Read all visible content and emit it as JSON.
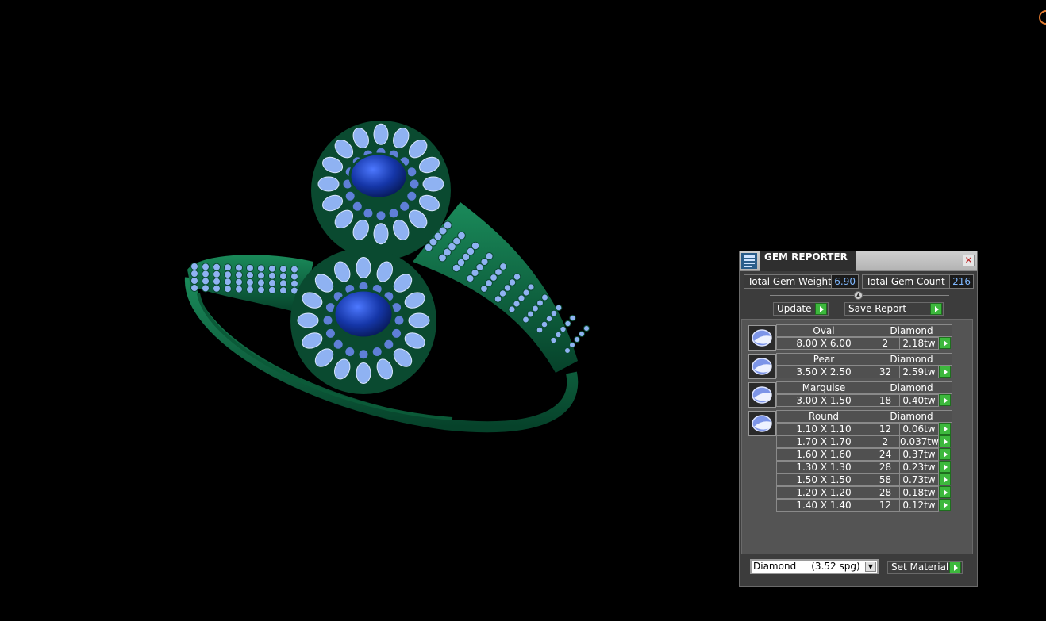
{
  "panel": {
    "title": "GEM REPORTER",
    "close_glyph": "✕",
    "total_weight_label": "Total Gem Weight",
    "total_weight_value": "6.90",
    "total_count_label": "Total Gem Count",
    "total_count_value": "216",
    "update_label": "Update",
    "save_report_label": "Save Report",
    "material_value": "Diamond     (3.52 spg)",
    "set_material_label": "Set Material"
  },
  "gem_groups": [
    {
      "shape": "Oval",
      "material": "Diamond",
      "rows": [
        {
          "size": "8.00 X 6.00",
          "count": "2",
          "weight": "2.18tw"
        }
      ]
    },
    {
      "shape": "Pear",
      "material": "Diamond",
      "rows": [
        {
          "size": "3.50 X 2.50",
          "count": "32",
          "weight": "2.59tw"
        }
      ]
    },
    {
      "shape": "Marquise",
      "material": "Diamond",
      "rows": [
        {
          "size": "3.00 X 1.50",
          "count": "18",
          "weight": "0.40tw"
        }
      ]
    },
    {
      "shape": "Round",
      "material": "Diamond",
      "rows": [
        {
          "size": "1.10 X 1.10",
          "count": "12",
          "weight": "0.06tw"
        },
        {
          "size": "1.70 X 1.70",
          "count": "2",
          "weight": "0.037tw"
        },
        {
          "size": "1.60 X 1.60",
          "count": "24",
          "weight": "0.37tw"
        },
        {
          "size": "1.30 X 1.30",
          "count": "28",
          "weight": "0.23tw"
        },
        {
          "size": "1.50 X 1.50",
          "count": "58",
          "weight": "0.73tw"
        },
        {
          "size": "1.20 X 1.20",
          "count": "28",
          "weight": "0.18tw"
        },
        {
          "size": "1.40 X 1.40",
          "count": "12",
          "weight": "0.12tw"
        }
      ]
    }
  ],
  "icons": {
    "title": "gem-reporter-icon",
    "close": "close-icon",
    "go": "play-arrow-icon",
    "dropdown": "chevron-down-icon"
  },
  "colors": {
    "metal": "#0f6b43",
    "center_stone": "#1a3fae",
    "small_stone": "#8fb2f2",
    "go_button": "#3db83d",
    "value_text": "#7fb8ff"
  }
}
